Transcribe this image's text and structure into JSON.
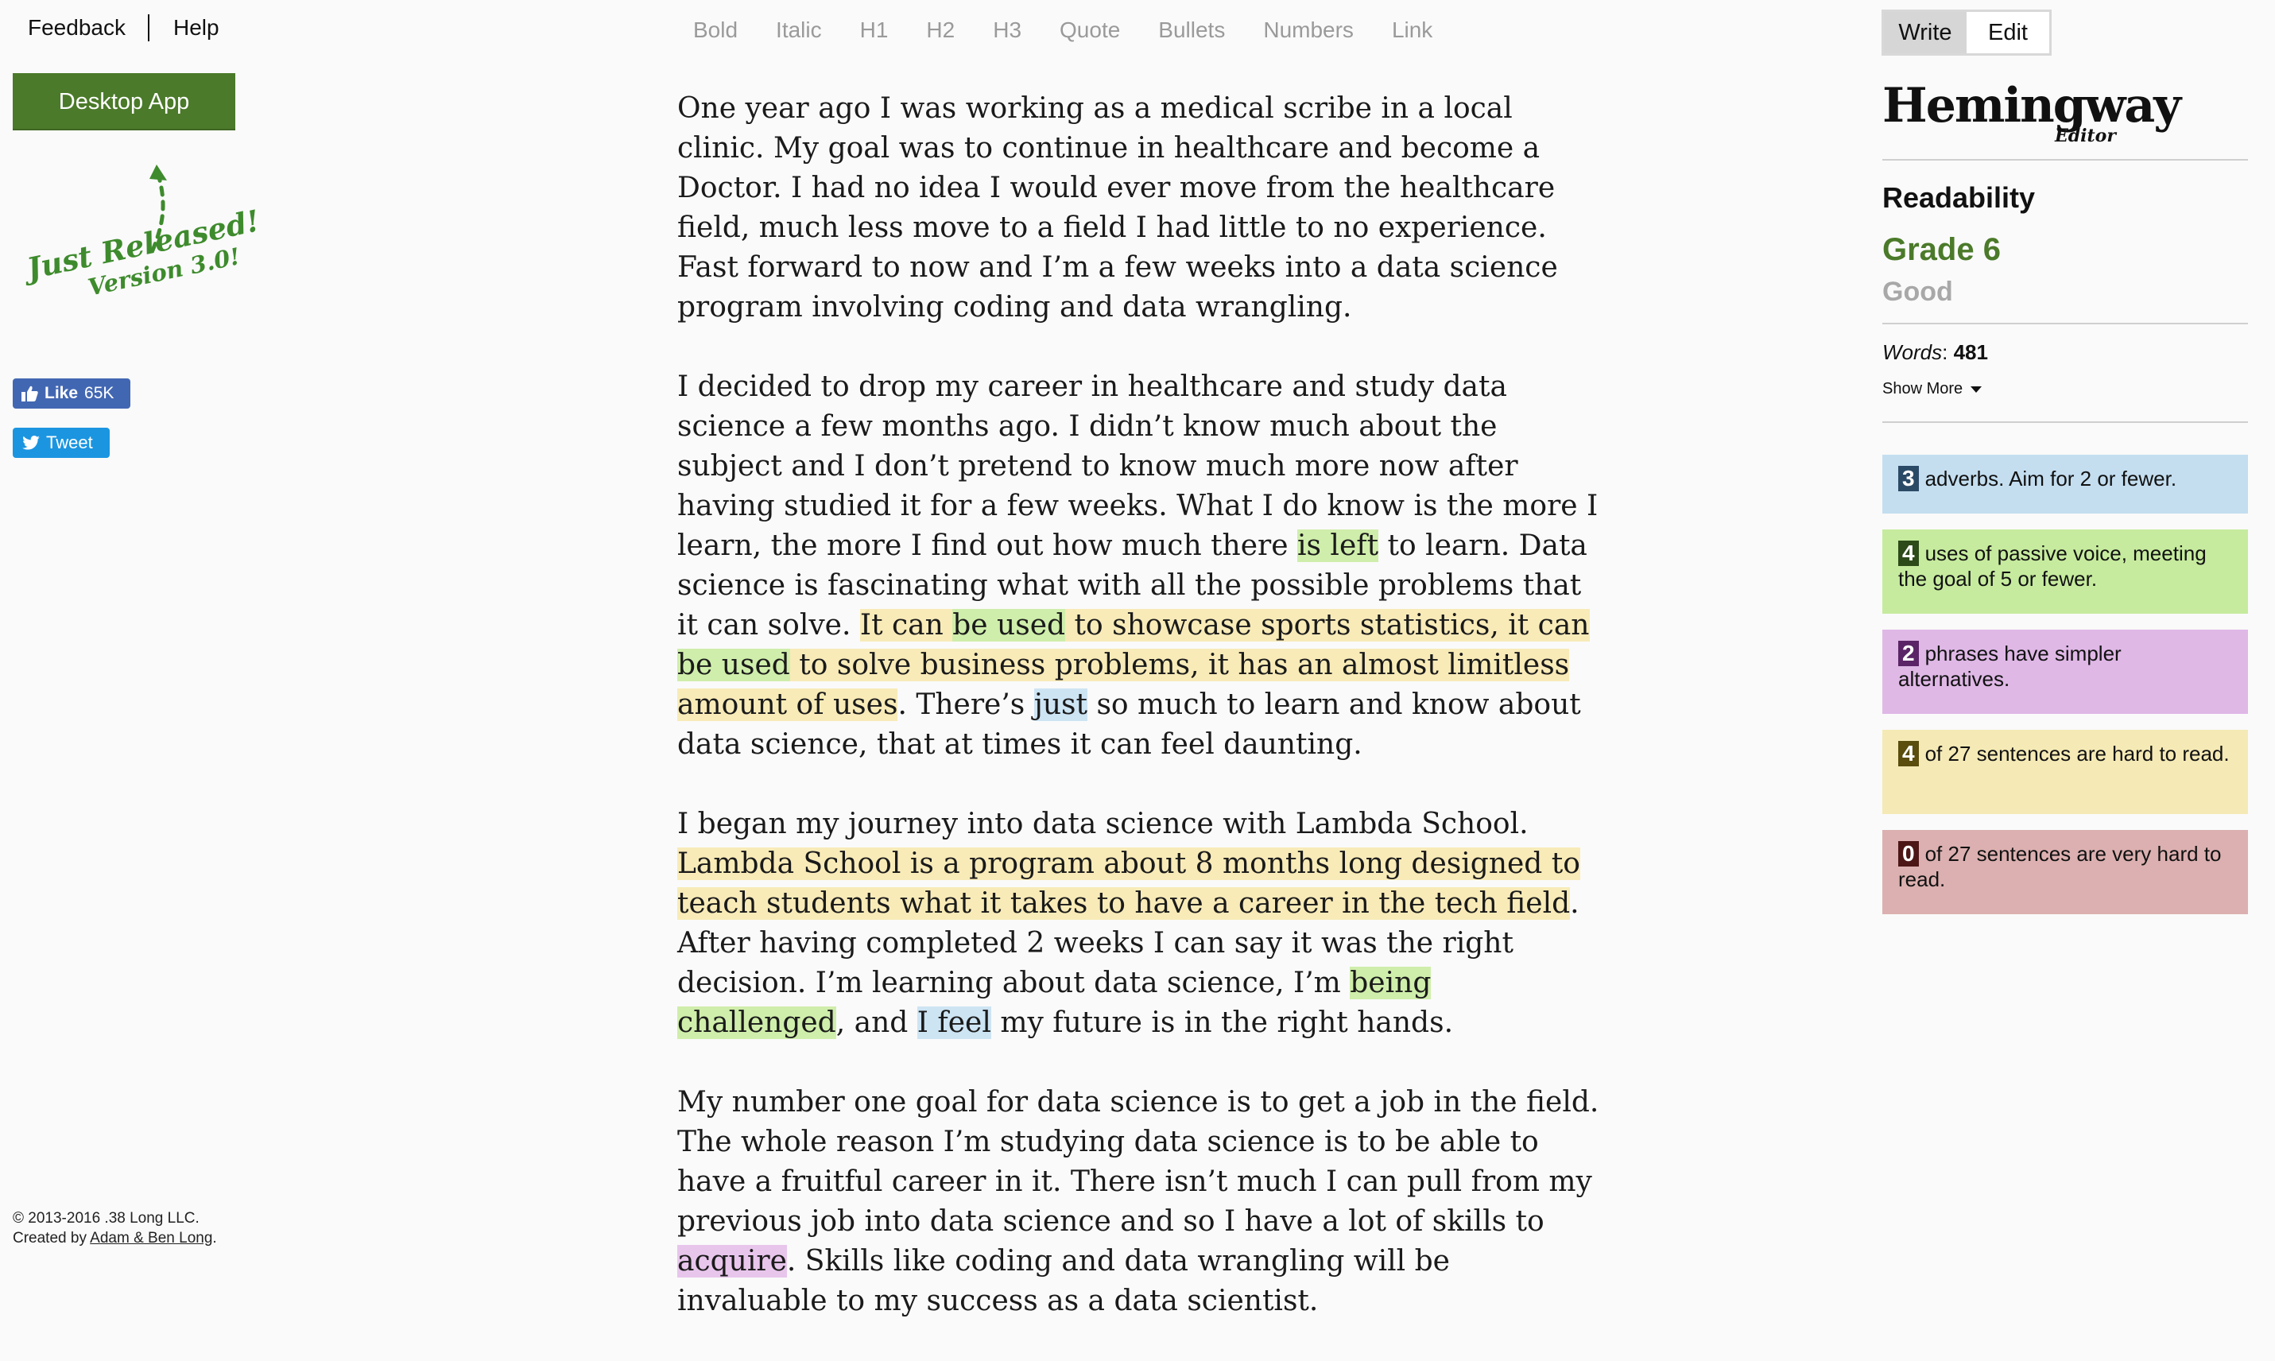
{
  "nav": {
    "feedback": "Feedback",
    "help": "Help"
  },
  "desktop_button": "Desktop App",
  "promo": {
    "line1": "Just Released!",
    "line2": "Version 3.0!"
  },
  "social": {
    "like_label": "Like",
    "like_count": "65K",
    "tweet_label": "Tweet"
  },
  "footer": {
    "copyright": "© 2013-2016 .38 Long LLC.",
    "created_prefix": "Created by ",
    "created_link": "Adam & Ben Long",
    "created_suffix": "."
  },
  "toolbar": {
    "bold": "Bold",
    "italic": "Italic",
    "h1": "H1",
    "h2": "H2",
    "h3": "H3",
    "quote": "Quote",
    "bullets": "Bullets",
    "numbers": "Numbers",
    "link": "Link"
  },
  "mode": {
    "write": "Write",
    "edit": "Edit",
    "active": "edit"
  },
  "logo": {
    "title": "Hemingway",
    "subtitle": "Editor"
  },
  "readability": {
    "title": "Readability",
    "grade": "Grade 6",
    "rating": "Good"
  },
  "words": {
    "label": "Words",
    "separator": ": ",
    "count": "481"
  },
  "show_more": "Show More",
  "stats": {
    "adverbs": {
      "count": "3",
      "text": "adverbs. Aim for 2 or fewer.",
      "color": "#c4def0"
    },
    "passive": {
      "count": "4",
      "text": "uses of passive voice, meeting the goal of 5 or fewer.",
      "color": "#c6eb9e"
    },
    "simpler": {
      "count": "2",
      "text": "phrases have simpler alternatives.",
      "color": "#dfb8e6"
    },
    "hard": {
      "count": "4",
      "text": "of 27 sentences are hard to read.",
      "color": "#f5eab5"
    },
    "very_hard": {
      "count": "0",
      "text": "of 27 sentences are very hard to read.",
      "color": "#dcb0b0"
    }
  },
  "editor": {
    "p1": "One year ago I was working as a medical scribe in a local clinic. My goal was to continue in healthcare and become a Doctor. I had no idea I would ever move from the healthcare field, much less move to a field I had little to no experience. Fast forward to now and I’m a few weeks into a data science program involving coding and data wrangling.",
    "p2": {
      "a": "I decided to drop my career in healthcare and study data science a few months ago. I didn’t know much about the subject and I don’t pretend to know much more now after having studied it for a few weeks. What I do know is the more I learn, the more I find out how much there ",
      "b": "is left",
      "c": " to learn. Data science is fascinating what with all the possible problems that it can solve. ",
      "d": "It can ",
      "e": "be used",
      "f": " to showcase sports statistics, it can ",
      "g": "be used",
      "h": " to solve business problems, it has an almost limitless amount of uses",
      "i": ". There’s ",
      "j": "just",
      "k": " so much to learn and know about data science, that at times it can feel daunting."
    },
    "p3": {
      "a": "I began my journey into data science with Lambda School. ",
      "b": "Lambda School is a program about 8 months long designed to teach students what it takes to have a career in the tech field",
      "c": ". After having completed 2 weeks I can say it was the right decision. I’m learning about data science, I’m ",
      "d": "being challenged",
      "e": ", and ",
      "f": "I feel",
      "g": " my future is in the right hands."
    },
    "p4": {
      "a": "My number one goal for data science is to get a job in the field. The whole reason I’m studying data science is to be able to have a fruitful career in it. There isn’t much I can pull from my previous job into data science and so I have a lot of skills to ",
      "b": "acquire",
      "c": ". Skills like coding and data wrangling will be invaluable to my success as a data scientist."
    }
  }
}
